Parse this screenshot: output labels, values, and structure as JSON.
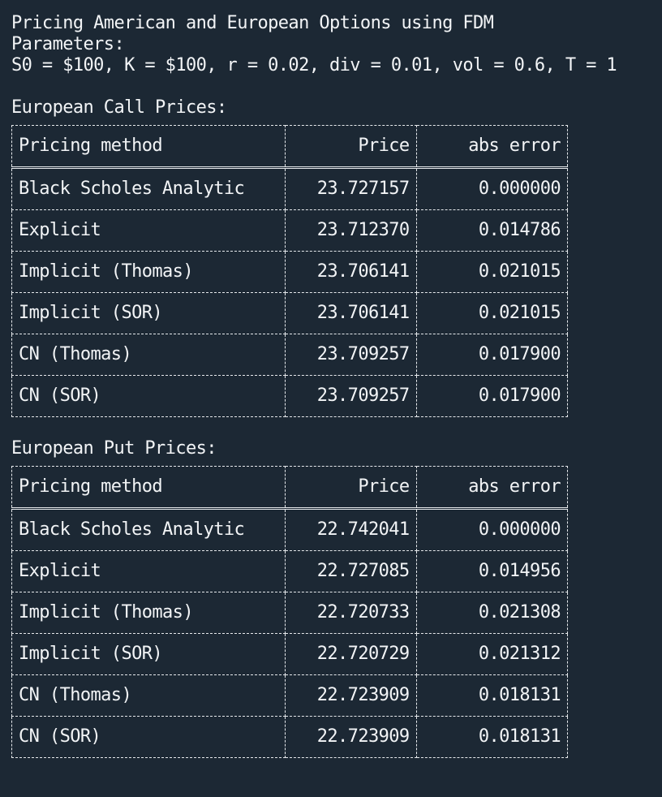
{
  "header": {
    "title": "Pricing American and European Options using FDM",
    "params_label": "Parameters:",
    "params_line": "S0 = $100, K = $100, r = 0.02, div = 0.01, vol = 0.6, T = 1"
  },
  "columns": {
    "method": "Pricing method",
    "price": "Price",
    "error": "abs error"
  },
  "call": {
    "title": "European Call Prices:",
    "rows": [
      {
        "method": "Black Scholes Analytic",
        "price": "23.727157",
        "error": "0.000000"
      },
      {
        "method": "Explicit",
        "price": "23.712370",
        "error": "0.014786"
      },
      {
        "method": "Implicit (Thomas)",
        "price": "23.706141",
        "error": "0.021015"
      },
      {
        "method": "Implicit (SOR)",
        "price": "23.706141",
        "error": "0.021015"
      },
      {
        "method": "CN (Thomas)",
        "price": "23.709257",
        "error": "0.017900"
      },
      {
        "method": "CN (SOR)",
        "price": "23.709257",
        "error": "0.017900"
      }
    ]
  },
  "put": {
    "title": "European Put Prices:",
    "rows": [
      {
        "method": "Black Scholes Analytic",
        "price": "22.742041",
        "error": "0.000000"
      },
      {
        "method": "Explicit",
        "price": "22.727085",
        "error": "0.014956"
      },
      {
        "method": "Implicit (Thomas)",
        "price": "22.720733",
        "error": "0.021308"
      },
      {
        "method": "Implicit (SOR)",
        "price": "22.720729",
        "error": "0.021312"
      },
      {
        "method": "CN (Thomas)",
        "price": "22.723909",
        "error": "0.018131"
      },
      {
        "method": "CN (SOR)",
        "price": "22.723909",
        "error": "0.018131"
      }
    ]
  }
}
